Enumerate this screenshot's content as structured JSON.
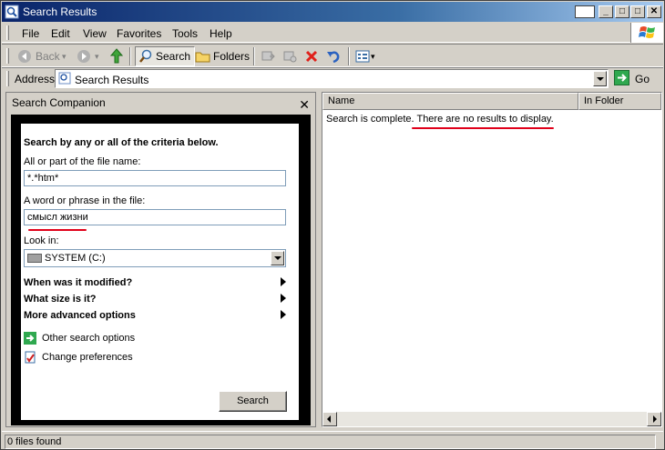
{
  "window": {
    "title": "Search Results"
  },
  "menu": {
    "file": "File",
    "edit": "Edit",
    "view": "View",
    "favorites": "Favorites",
    "tools": "Tools",
    "help": "Help"
  },
  "toolbar": {
    "back": "Back",
    "search": "Search",
    "folders": "Folders"
  },
  "address": {
    "label": "Address",
    "value": "Search Results",
    "go": "Go"
  },
  "companion": {
    "title": "Search Companion",
    "heading": "Search by any or all of the criteria below.",
    "filename_label": "All or part of the file name:",
    "filename_value": "*.*htm*",
    "phrase_label": "A word or phrase in the file:",
    "phrase_value": "смысл жизни",
    "lookin_label": "Look in:",
    "lookin_value": "SYSTEM (C:)",
    "opt_modified": "When was it modified?",
    "opt_size": "What size is it?",
    "opt_advanced": "More advanced options",
    "link_other": "Other search options",
    "link_prefs": "Change preferences",
    "search_button": "Search"
  },
  "results": {
    "col_name": "Name",
    "col_folder": "In Folder",
    "msg_prefix": "Search is complete.",
    "msg_highlight": "There are no results to display."
  },
  "status": {
    "text": "0 files found"
  },
  "colors": {
    "title_start": "#0a246a",
    "title_end": "#a6caf0",
    "underline_red": "#e0001a"
  }
}
